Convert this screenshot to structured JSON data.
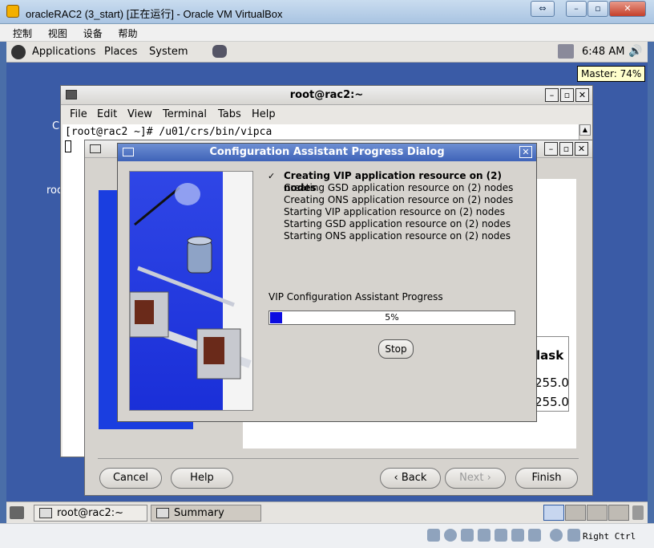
{
  "host": {
    "window_title": "oracleRAC2 (3_start) [正在运行] - Oracle VM VirtualBox",
    "menu": [
      "控制",
      "视图",
      "设备",
      "帮助"
    ],
    "host_key": "Right Ctrl"
  },
  "gnome_panel": {
    "menus": [
      "Applications",
      "Places",
      "System"
    ],
    "clock": "6:48 AM",
    "volume_tooltip": "Master: 74%"
  },
  "desktop": {
    "left_text_1": "C",
    "left_text_2": "roo"
  },
  "terminal": {
    "title": "root@rac2:~",
    "menu": [
      "File",
      "Edit",
      "View",
      "Terminal",
      "Tabs",
      "Help"
    ],
    "prompt_line": "[root@rac2 ~]# /u01/crs/bin/vipca"
  },
  "vipca": {
    "table_header": "lask",
    "row1": "255.0",
    "row2": "255.0",
    "buttons": {
      "cancel": "Cancel",
      "help": "Help",
      "back": "Back",
      "next": "Next",
      "finish": "Finish"
    }
  },
  "dialog": {
    "title": "Configuration Assistant Progress Dialog",
    "tasks": [
      {
        "label": "Creating VIP application resource on (2) nodes",
        "status": "in-progress"
      },
      {
        "label": "Creating GSD application resource on (2) nodes",
        "status": "pending"
      },
      {
        "label": "Creating ONS application resource on (2) nodes",
        "status": "pending"
      },
      {
        "label": "Starting VIP application resource on (2) nodes",
        "status": "pending"
      },
      {
        "label": "Starting GSD application resource on (2) nodes",
        "status": "pending"
      },
      {
        "label": "Starting ONS application resource on (2) nodes",
        "status": "pending"
      }
    ],
    "progress_label": "VIP Configuration Assistant Progress",
    "progress_value": 0.05,
    "progress_text": "5%",
    "stop_label": "Stop"
  },
  "taskbar": {
    "items": [
      {
        "label": "root@rac2:~",
        "active": false
      },
      {
        "label": "Summary",
        "active": true
      }
    ]
  }
}
